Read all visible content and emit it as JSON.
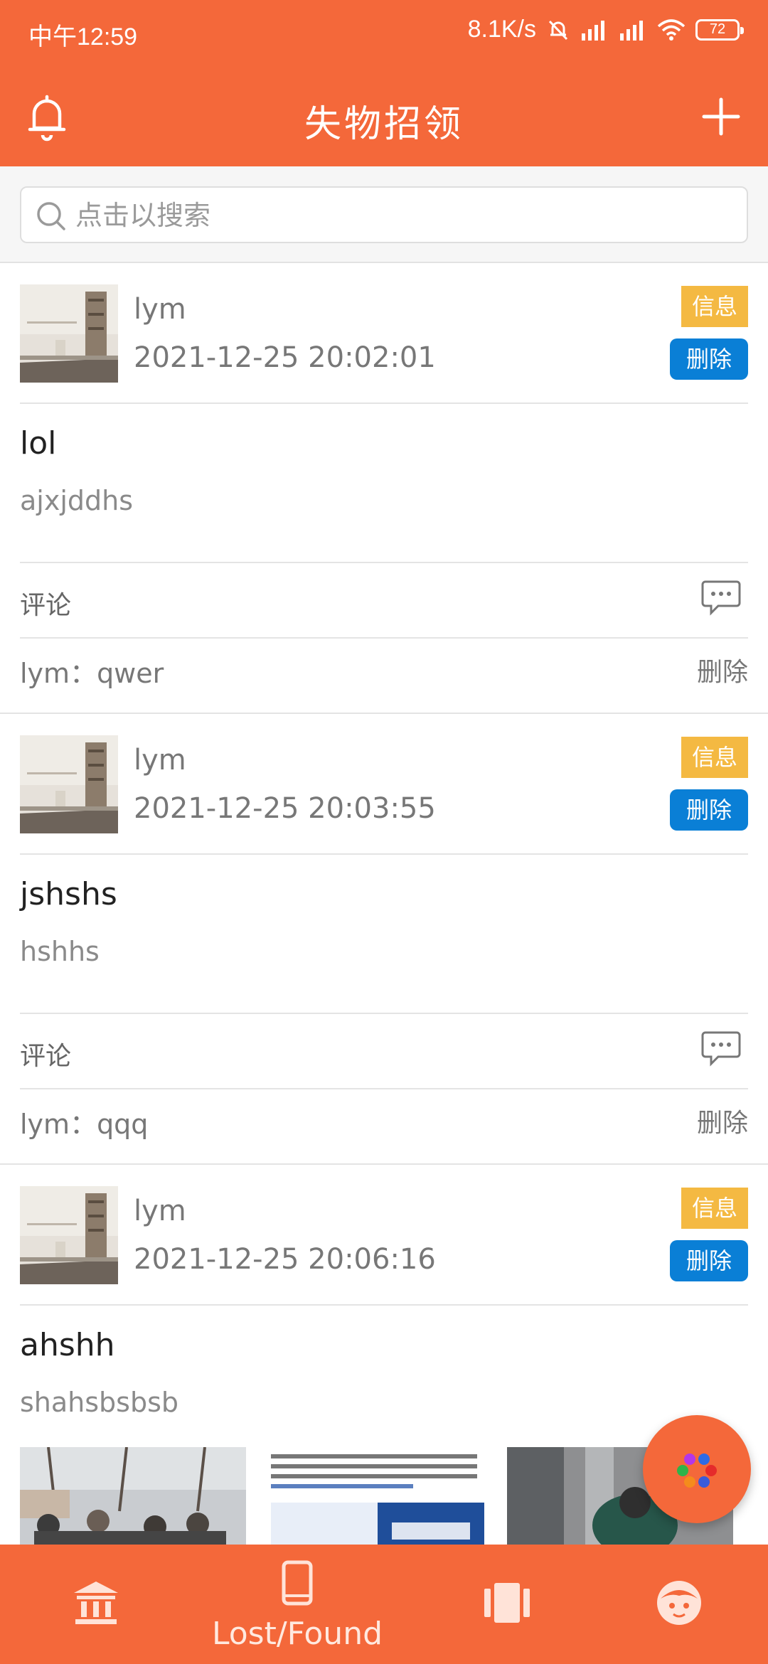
{
  "status_bar": {
    "time": "中午12:59",
    "net_speed": "8.1K/s",
    "battery": "72"
  },
  "header": {
    "title": "失物招领",
    "bell_icon": "bell-icon",
    "add_icon": "plus-icon",
    "color": "#f4683a"
  },
  "search": {
    "placeholder": "点击以搜索",
    "icon": "search-icon"
  },
  "posts": [
    {
      "user": "lym",
      "time": "2021-12-25 20:02:01",
      "info_label": "信息",
      "delete_label": "删除",
      "title": "lol",
      "description": "ajxjddhs",
      "comments_label": "评论",
      "comment": "lym：qwer",
      "comment_delete": "删除"
    },
    {
      "user": "lym",
      "time": "2021-12-25 20:03:55",
      "info_label": "信息",
      "delete_label": "删除",
      "title": "jshshs",
      "description": "hshhs",
      "comments_label": "评论",
      "comment": "lym：qqq",
      "comment_delete": "删除"
    },
    {
      "user": "lym",
      "time": "2021-12-25 20:06:16",
      "info_label": "信息",
      "delete_label": "删除",
      "title": "ahshh",
      "description": "shahsbsbsb"
    }
  ],
  "bottom_nav": {
    "items": [
      {
        "icon": "bank-icon",
        "label": ""
      },
      {
        "icon": "phone-icon",
        "label": "Lost/Found"
      },
      {
        "icon": "carousel-icon",
        "label": ""
      },
      {
        "icon": "face-icon",
        "label": ""
      }
    ]
  },
  "colors": {
    "accent": "#f4683a",
    "info_badge": "#f4b942",
    "delete_badge": "#0a7fd6"
  }
}
